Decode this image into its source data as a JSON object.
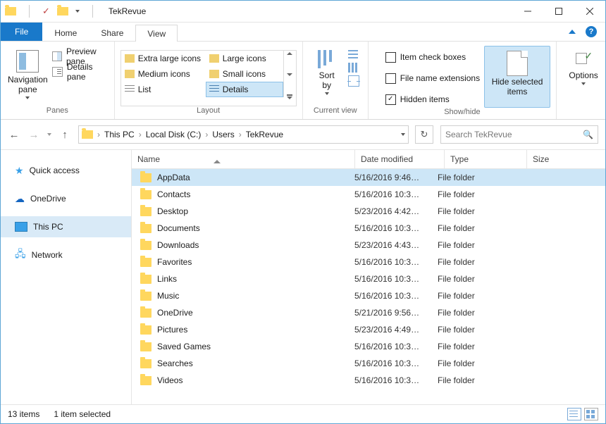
{
  "title": "TekRevue",
  "tabs": {
    "file": "File",
    "home": "Home",
    "share": "Share",
    "view": "View"
  },
  "ribbon": {
    "panes": {
      "label": "Panes",
      "navpane": "Navigation\npane",
      "preview": "Preview pane",
      "details": "Details pane"
    },
    "layout": {
      "label": "Layout",
      "items": [
        "Extra large icons",
        "Large icons",
        "Medium icons",
        "Small icons",
        "List",
        "Details"
      ]
    },
    "currentview": {
      "label": "Current view",
      "sortby": "Sort\nby"
    },
    "showhide": {
      "label": "Show/hide",
      "checkboxes": "Item check boxes",
      "extensions": "File name extensions",
      "hidden": "Hidden items",
      "hideselected": "Hide selected\nitems"
    },
    "options": "Options"
  },
  "breadcrumbs": [
    "This PC",
    "Local Disk (C:)",
    "Users",
    "TekRevue"
  ],
  "search_placeholder": "Search TekRevue",
  "columns": {
    "name": "Name",
    "date": "Date modified",
    "type": "Type",
    "size": "Size"
  },
  "sidebar": {
    "quick": "Quick access",
    "onedrive": "OneDrive",
    "thispc": "This PC",
    "network": "Network"
  },
  "rows": [
    {
      "name": "AppData",
      "date": "5/16/2016 9:46…",
      "type": "File folder",
      "sel": true
    },
    {
      "name": "Contacts",
      "date": "5/16/2016 10:3…",
      "type": "File folder"
    },
    {
      "name": "Desktop",
      "date": "5/23/2016 4:42…",
      "type": "File folder"
    },
    {
      "name": "Documents",
      "date": "5/16/2016 10:3…",
      "type": "File folder"
    },
    {
      "name": "Downloads",
      "date": "5/23/2016 4:43…",
      "type": "File folder"
    },
    {
      "name": "Favorites",
      "date": "5/16/2016 10:3…",
      "type": "File folder"
    },
    {
      "name": "Links",
      "date": "5/16/2016 10:3…",
      "type": "File folder"
    },
    {
      "name": "Music",
      "date": "5/16/2016 10:3…",
      "type": "File folder"
    },
    {
      "name": "OneDrive",
      "date": "5/21/2016 9:56…",
      "type": "File folder"
    },
    {
      "name": "Pictures",
      "date": "5/23/2016 4:49…",
      "type": "File folder"
    },
    {
      "name": "Saved Games",
      "date": "5/16/2016 10:3…",
      "type": "File folder"
    },
    {
      "name": "Searches",
      "date": "5/16/2016 10:3…",
      "type": "File folder"
    },
    {
      "name": "Videos",
      "date": "5/16/2016 10:3…",
      "type": "File folder"
    }
  ],
  "status": {
    "count": "13 items",
    "selected": "1 item selected"
  }
}
